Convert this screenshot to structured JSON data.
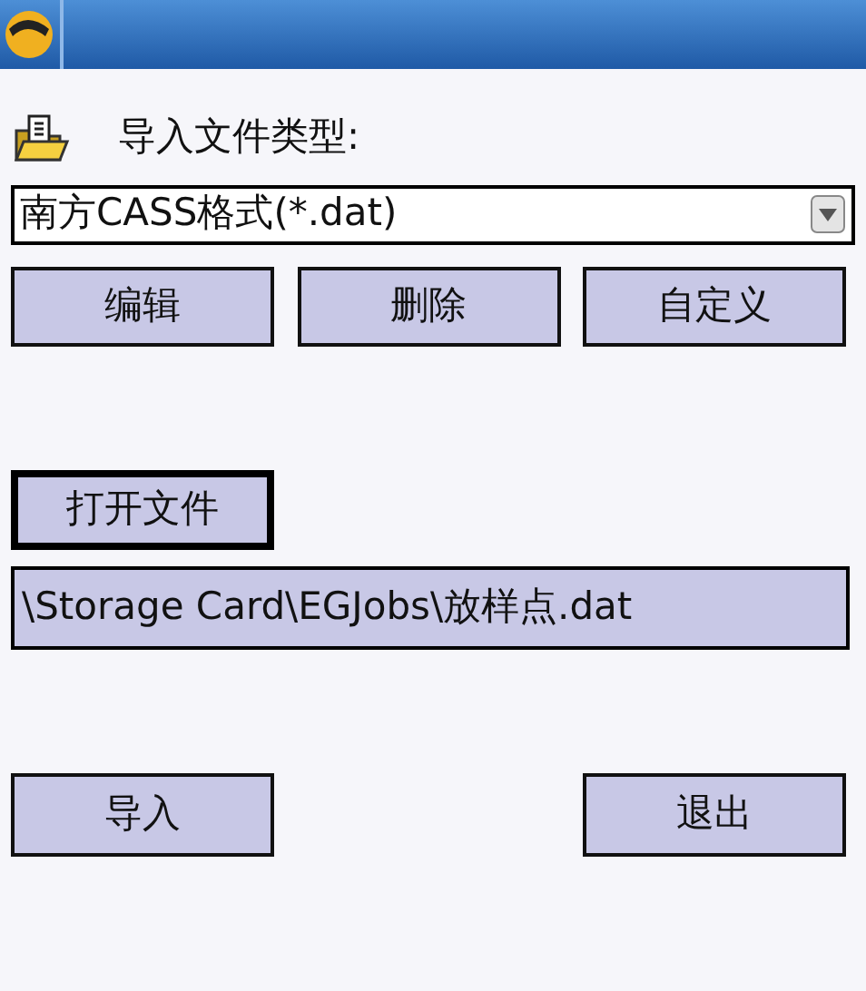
{
  "file_type": {
    "label": "导入文件类型:",
    "value": "南方CASS格式(*.dat)"
  },
  "type_buttons": [
    {
      "label": "编辑"
    },
    {
      "label": "删除"
    },
    {
      "label": "自定义"
    }
  ],
  "open_button": {
    "label": "打开文件",
    "focused": true
  },
  "file_path": {
    "value": "\\Storage Card\\EGJobs\\放样点.dat"
  },
  "bottom_buttons": [
    {
      "label": "导入",
      "focused": false
    },
    {
      "label": "退出",
      "focused": false
    }
  ]
}
